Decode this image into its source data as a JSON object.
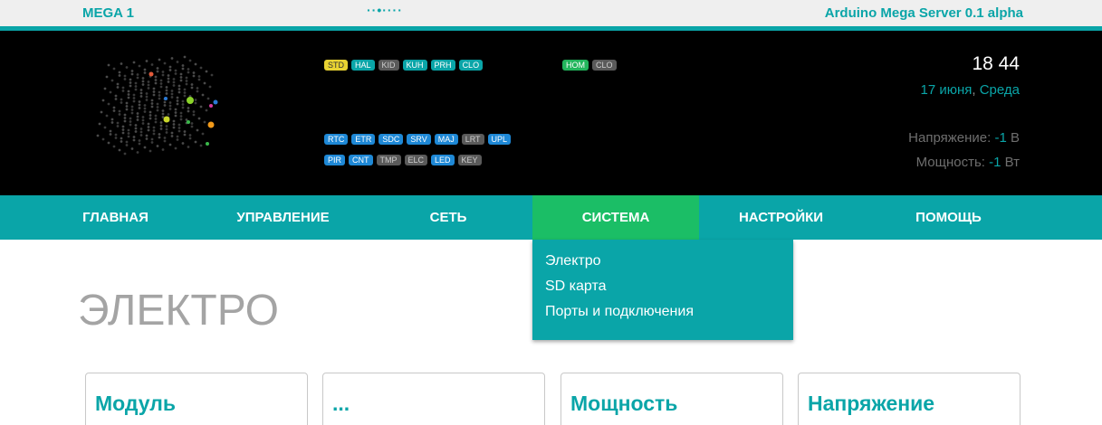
{
  "topbar": {
    "left": "MEGA 1",
    "center": "··•····",
    "right": "Arduino Mega Server 0.1 alpha"
  },
  "header": {
    "badges_row1": [
      {
        "label": "STD",
        "color": "yellow"
      },
      {
        "label": "HAL",
        "color": "teal"
      },
      {
        "label": "KID",
        "color": "gray"
      },
      {
        "label": "KUH",
        "color": "teal"
      },
      {
        "label": "PRH",
        "color": "teal"
      },
      {
        "label": "CLO",
        "color": "teal"
      }
    ],
    "badges_row1b": [
      {
        "label": "HOM",
        "color": "green"
      },
      {
        "label": "CLO",
        "color": "gray"
      }
    ],
    "badges_row2": [
      {
        "label": "RTC",
        "color": "blue"
      },
      {
        "label": "ETR",
        "color": "blue"
      },
      {
        "label": "SDC",
        "color": "blue"
      },
      {
        "label": "SRV",
        "color": "blue"
      },
      {
        "label": "MAJ",
        "color": "blue"
      },
      {
        "label": "LRT",
        "color": "gray"
      },
      {
        "label": "UPL",
        "color": "blue"
      }
    ],
    "badges_row3": [
      {
        "label": "PIR",
        "color": "blue"
      },
      {
        "label": "CNT",
        "color": "blue"
      },
      {
        "label": "TMP",
        "color": "gray"
      },
      {
        "label": "ELC",
        "color": "gray"
      },
      {
        "label": "LED",
        "color": "blue"
      },
      {
        "label": "KEY",
        "color": "gray"
      }
    ],
    "time": "18 44",
    "date_day": "17 июня",
    "date_comma": ",",
    "date_weekday": " Среда",
    "voltage_label": "Напряжение: ",
    "voltage_value": "-1",
    "voltage_unit": " В",
    "power_label": "Мощность: ",
    "power_value": "-1",
    "power_unit": " Вт"
  },
  "nav": {
    "items": [
      "ГЛАВНАЯ",
      "УПРАВЛЕНИЕ",
      "СЕТЬ",
      "СИСТЕМА",
      "НАСТРОЙКИ",
      "ПОМОЩЬ"
    ],
    "active_index": 3
  },
  "dropdown": {
    "items": [
      "Электро",
      "SD карта",
      "Порты и подключения"
    ]
  },
  "page": {
    "title": "ЭЛЕКТРО"
  },
  "cards": [
    "Модуль",
    "...",
    "Мощность",
    "Напряжение"
  ],
  "colors": {
    "accent": "#0aa5a8",
    "active_tab": "#1bbe66",
    "header_bg": "#000000"
  }
}
